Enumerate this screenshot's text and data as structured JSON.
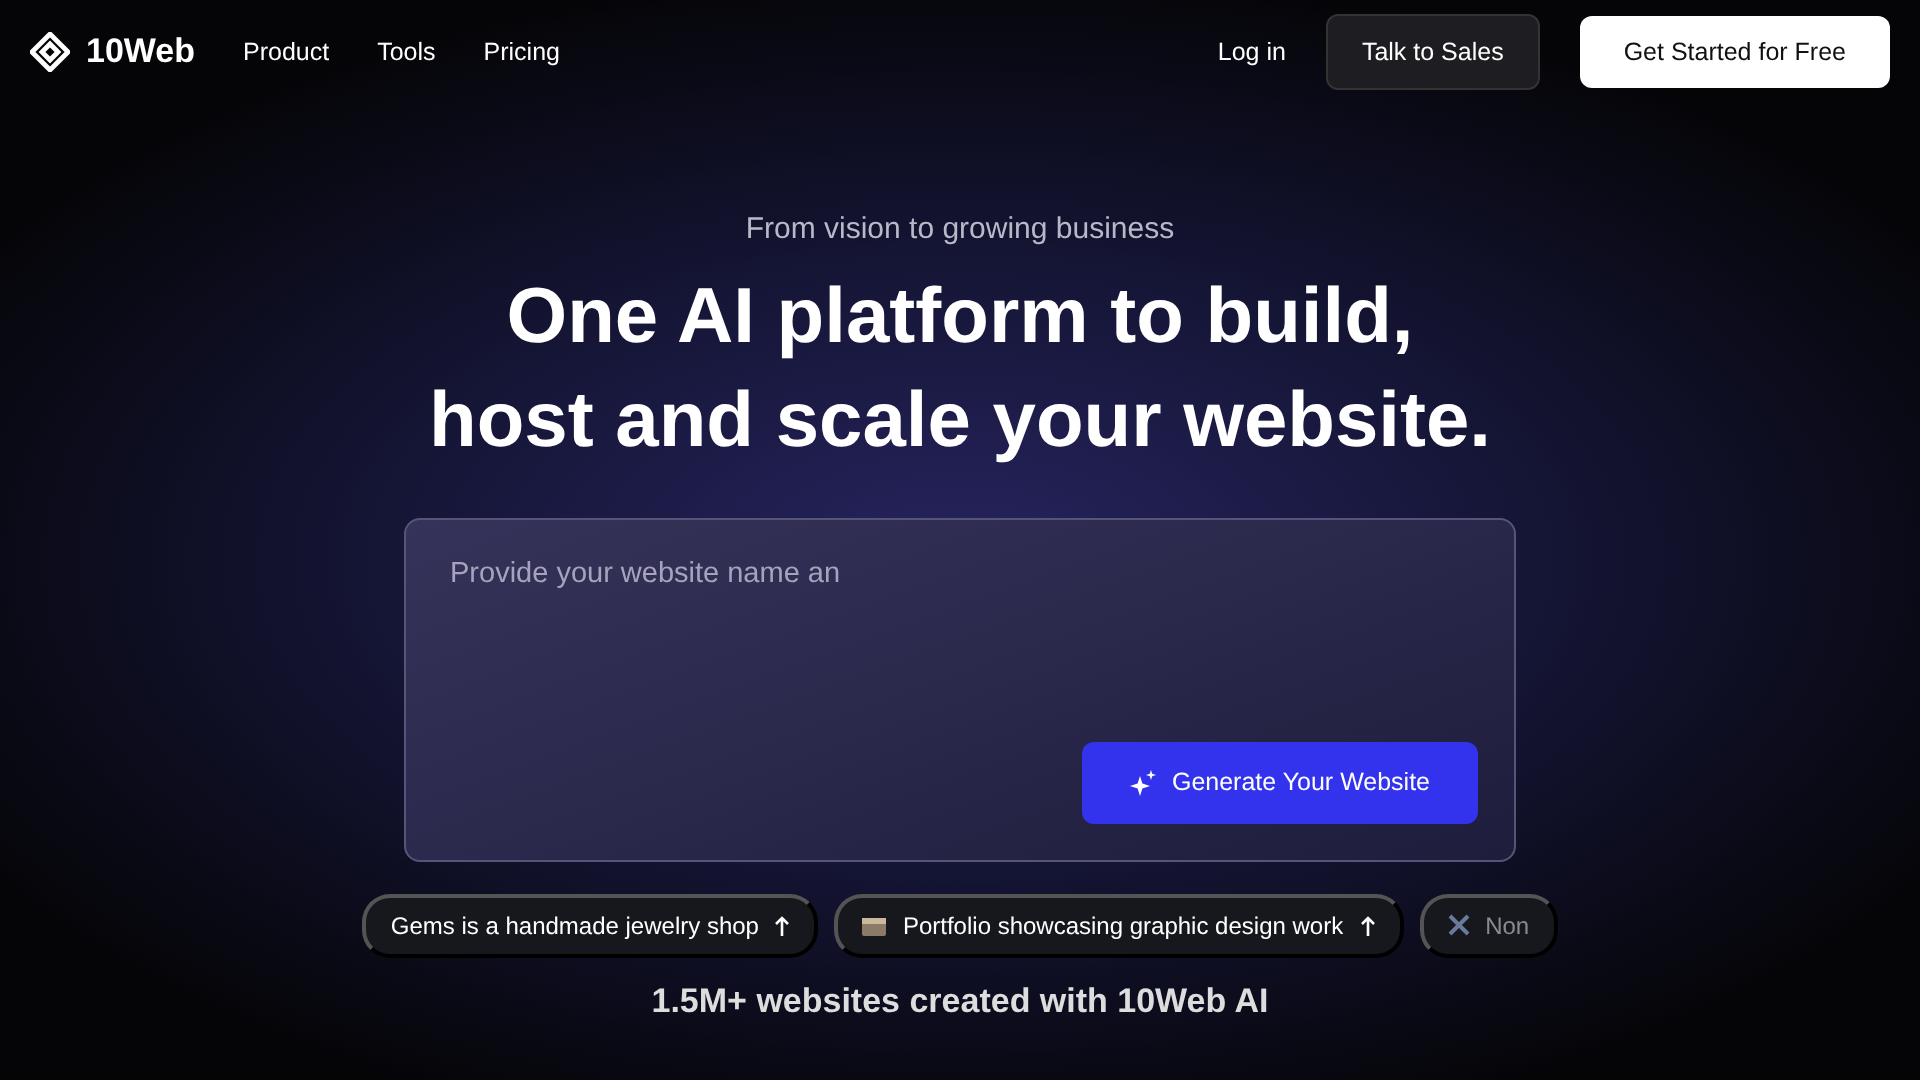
{
  "nav": {
    "brand": "10Web",
    "links": [
      "Product",
      "Tools",
      "Pricing"
    ],
    "login": "Log in",
    "sales": "Talk to Sales",
    "cta": "Get Started for Free"
  },
  "hero": {
    "tagline": "From vision to growing business",
    "title_lines": [
      "One AI platform to build,",
      "host and scale your website."
    ]
  },
  "prompt": {
    "placeholder": "Provide your website name an",
    "button": "Generate Your Website"
  },
  "suggestions": [
    {
      "label": "Gems is a handmade jewelry shop",
      "kind": "plain"
    },
    {
      "label": "Portfolio showcasing graphic design work",
      "kind": "box"
    },
    {
      "label": "Non",
      "kind": "tool"
    }
  ],
  "stat": "1.5M+ websites created with 10Web AI"
}
